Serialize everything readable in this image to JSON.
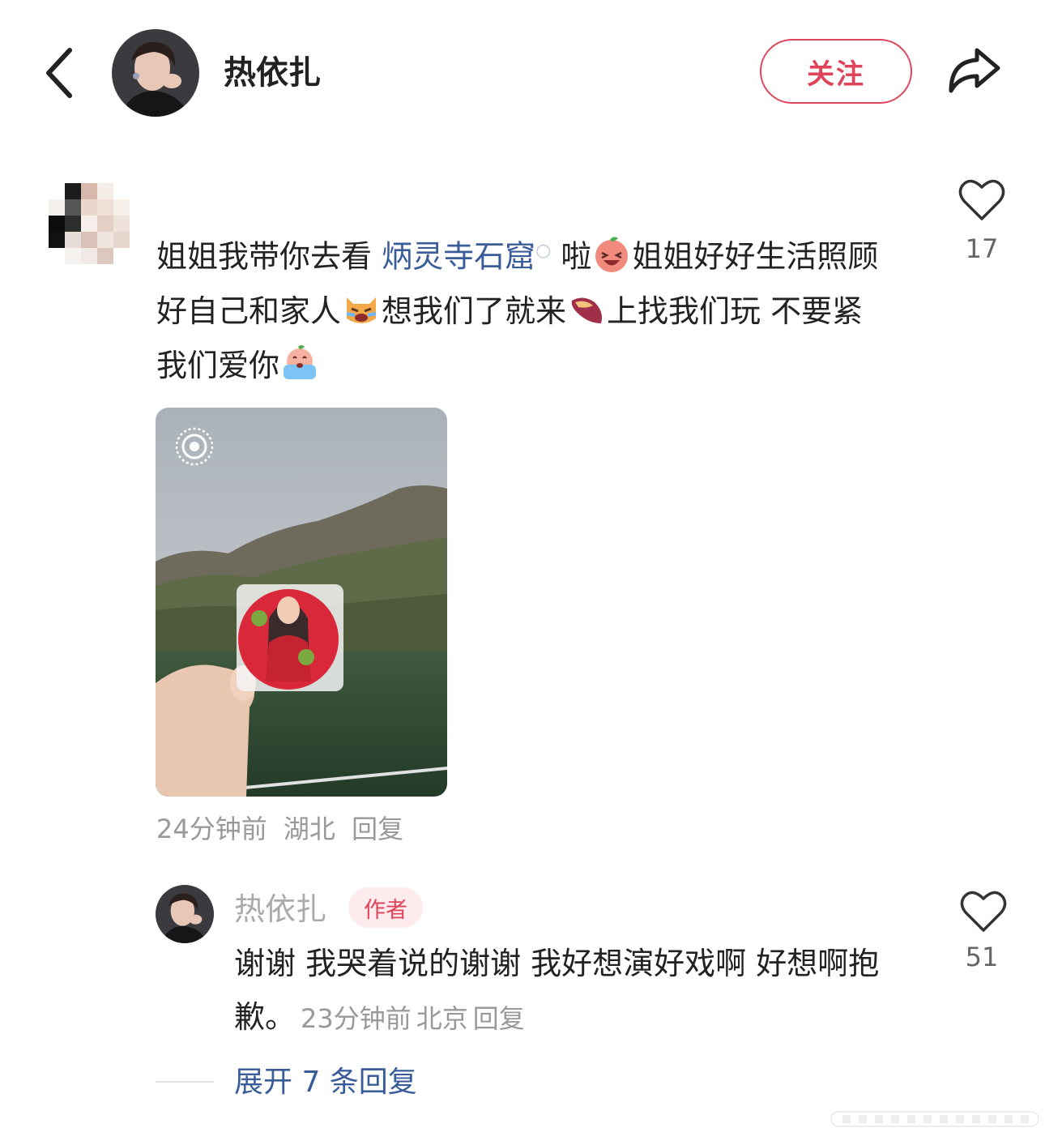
{
  "header": {
    "author_name": "热依扎",
    "follow_label": "关注",
    "icons": {
      "back": "chevron-left-icon",
      "share": "share-arrow-icon"
    }
  },
  "comment": {
    "text_parts": {
      "p1": "姐姐我带你去看 ",
      "topic": "炳灵寺石窟",
      "p2": " 啦",
      "p3": "姐姐好好生活照顾好自己和家人",
      "p4": "想我们了就来",
      "p5": "上找我们玩 不要紧 我们爱你"
    },
    "emojis": [
      "laughing-peach-emoji",
      "crying-cat-emoji",
      "sweet-potato-emoji",
      "crying-peach-emoji"
    ],
    "likes": "17",
    "time": "24分钟前",
    "location": "湖北",
    "reply_label": "回复"
  },
  "reply": {
    "name": "热依扎",
    "tag": "作者",
    "text": "谢谢 我哭着说的谢谢 我好想演好戏啊 好想啊抱歉。",
    "time": "23分钟前",
    "location": "北京",
    "reply_label": "回复",
    "likes": "51"
  },
  "expand_label": "展开 7 条回复",
  "colors": {
    "accent_red": "#e0445a",
    "link_blue": "#3a5d9a",
    "meta_gray": "#999999"
  }
}
